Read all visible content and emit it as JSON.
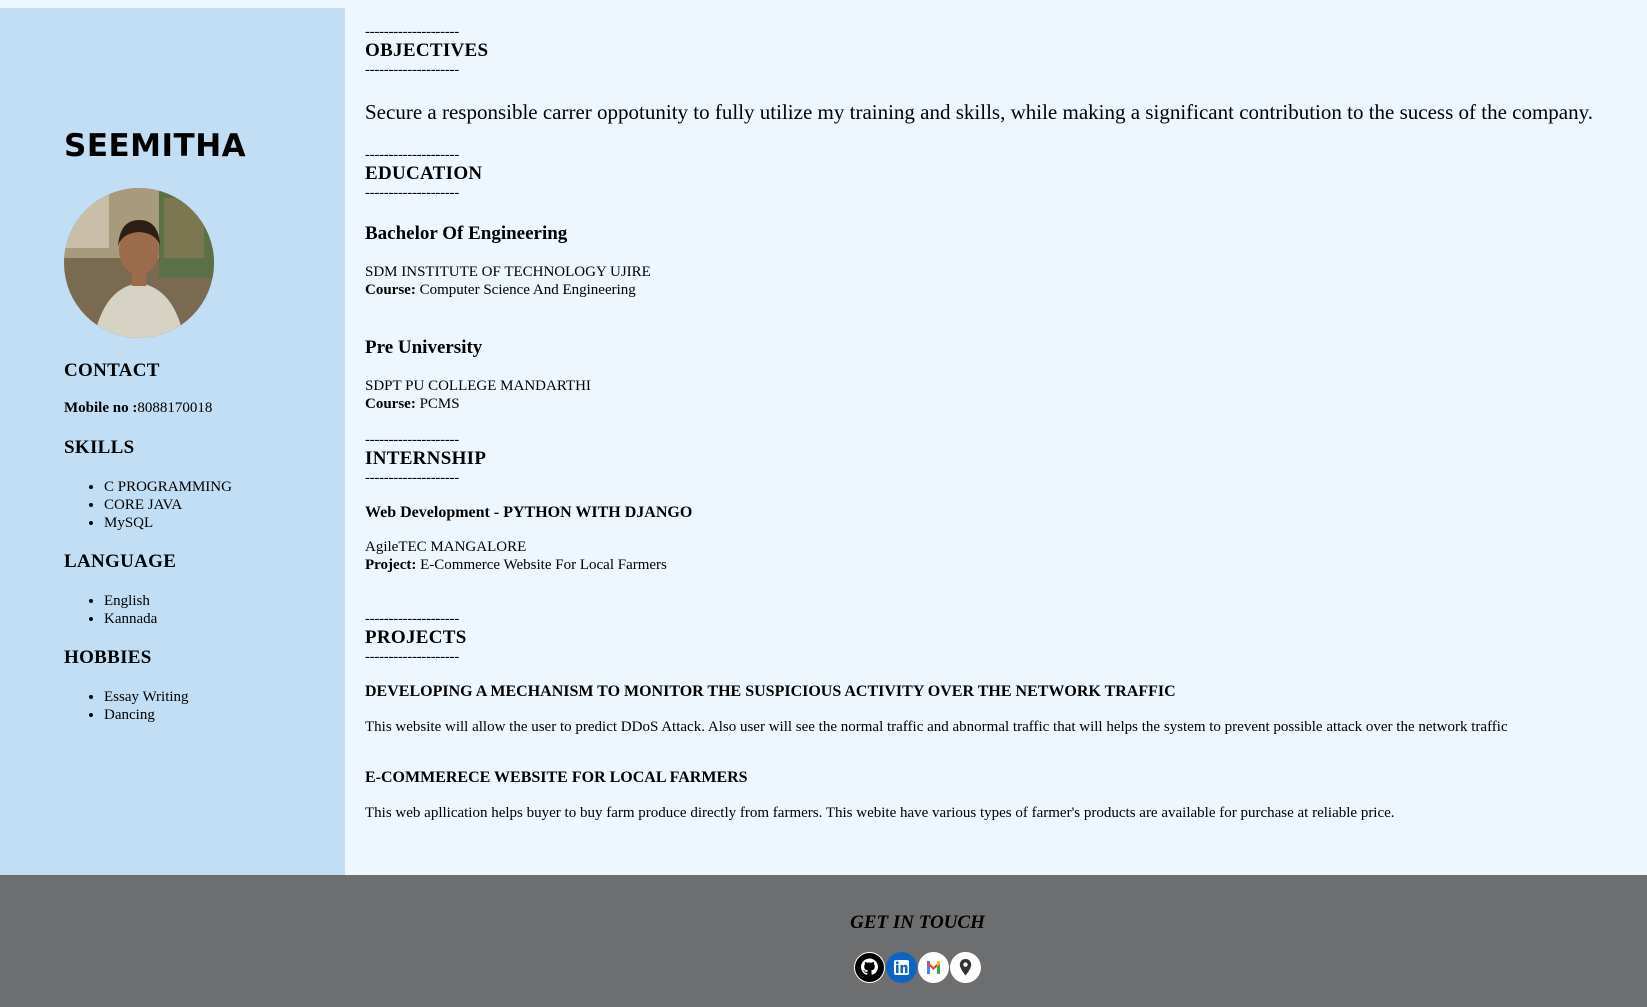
{
  "sidebar": {
    "name": "SEEMITHA",
    "contact_heading": "CONTACT",
    "mobile_label": "Mobile no :",
    "mobile_value": "8088170018",
    "skills_heading": "SKILLS",
    "skills": [
      "C PROGRAMMING",
      "CORE JAVA",
      "MySQL"
    ],
    "language_heading": "LANGUAGE",
    "languages": [
      "English",
      "Kannada"
    ],
    "hobbies_heading": "HOBBIES",
    "hobbies": [
      "Essay Writing",
      "Dancing"
    ]
  },
  "main": {
    "divider": "--------------------",
    "objectives": {
      "heading": "OBJECTIVES",
      "text": "Secure a responsible carrer oppotunity to fully utilize my training and skills, while making a significant contribution to the sucess of the company."
    },
    "education": {
      "heading": "EDUCATION",
      "items": [
        {
          "title": "Bachelor Of Engineering",
          "institute": "SDM INSTITUTE OF TECHNOLOGY UJIRE",
          "course_label": "Course:",
          "course": " Computer Science And Engineering"
        },
        {
          "title": "Pre University",
          "institute": "SDPT PU COLLEGE MANDARTHI",
          "course_label": "Course:",
          "course": " PCMS"
        }
      ]
    },
    "internship": {
      "heading": "INTERNSHIP",
      "title": "Web Development - PYTHON WITH DJANGO",
      "company": "AgileTEC MANGALORE",
      "project_label": "Project:",
      "project": " E-Commerce Website For Local Farmers"
    },
    "projects": {
      "heading": "PROJECTS",
      "items": [
        {
          "title": "DEVELOPING A MECHANISM TO MONITOR THE SUSPICIOUS ACTIVITY OVER THE NETWORK TRAFFIC",
          "description": "This website will allow the user to predict DDoS Attack. Also user will see the normal traffic and abnormal traffic that will helps the system to prevent possible attack over the network traffic"
        },
        {
          "title": "E-COMMERECE WEBSITE FOR LOCAL FARMERS",
          "description": "This web apllication helps buyer to buy farm produce directly from farmers. This webite have various types of farmer's products are available for purchase at reliable price."
        }
      ]
    }
  },
  "footer": {
    "title": "GET IN TOUCH",
    "icons": [
      "github-icon",
      "linkedin-icon",
      "gmail-icon",
      "map-pin-icon"
    ]
  }
}
